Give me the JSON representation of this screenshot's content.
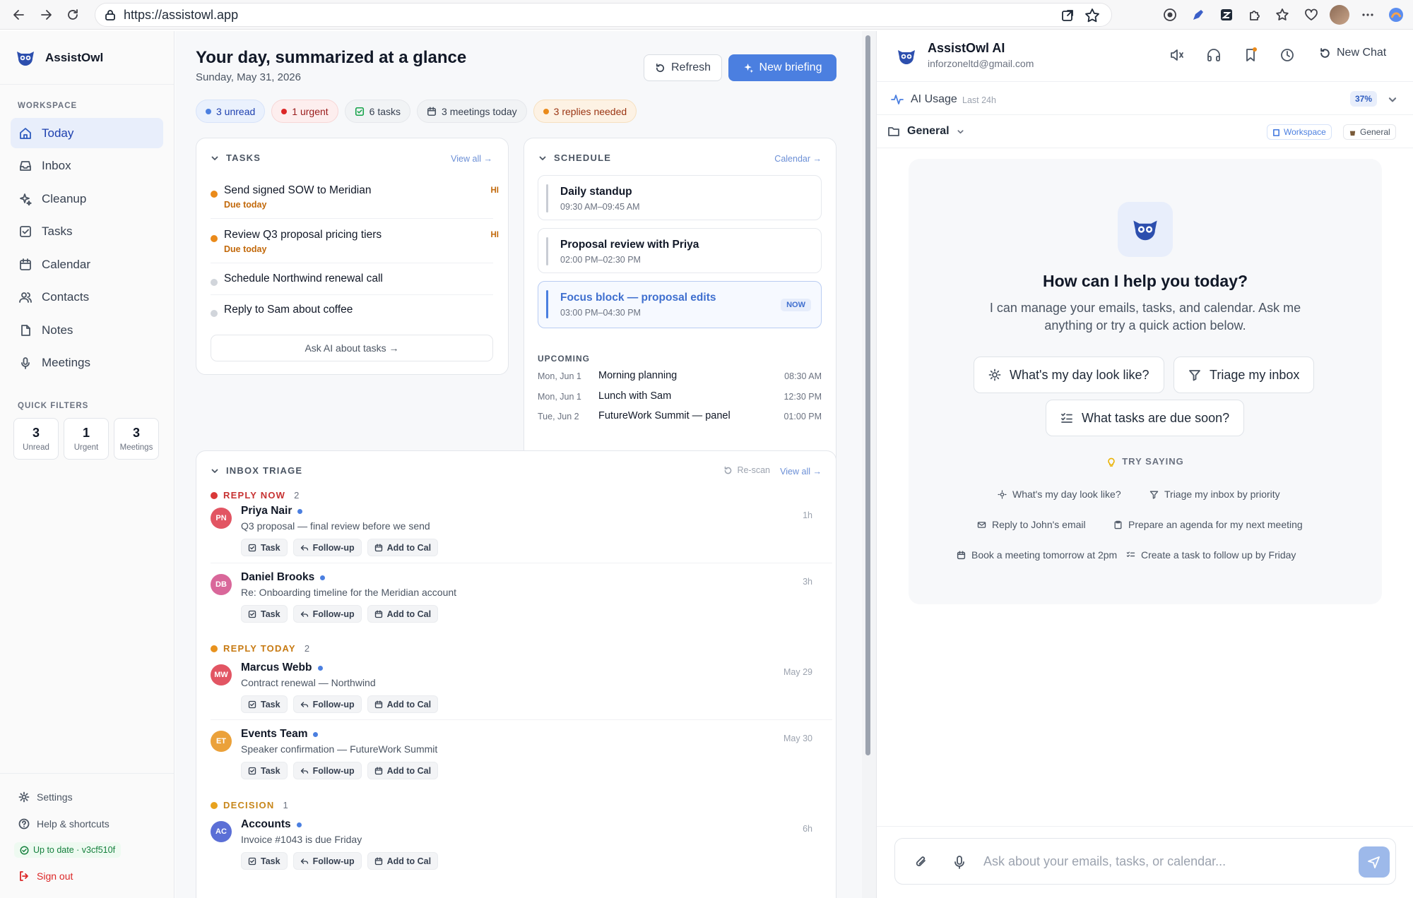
{
  "browser": {
    "url": "https://assistowl.app"
  },
  "sidebar": {
    "app_name": "AssistOwl",
    "workspace_label": "WORKSPACE",
    "nav": [
      {
        "label": "Today",
        "icon": "home-icon",
        "active": true
      },
      {
        "label": "Inbox",
        "icon": "inbox-icon"
      },
      {
        "label": "Cleanup",
        "icon": "sparkles-icon"
      },
      {
        "label": "Tasks",
        "icon": "checkbox-icon"
      },
      {
        "label": "Calendar",
        "icon": "calendar-icon"
      },
      {
        "label": "Contacts",
        "icon": "contacts-icon"
      },
      {
        "label": "Notes",
        "icon": "notes-icon"
      },
      {
        "label": "Meetings",
        "icon": "mic-icon"
      }
    ],
    "quick_filters_label": "QUICK FILTERS",
    "quick_filters": [
      {
        "count": "3",
        "label": "Unread"
      },
      {
        "count": "1",
        "label": "Urgent"
      },
      {
        "count": "3",
        "label": "Meetings"
      }
    ],
    "settings": "Settings",
    "help": "Help & shortcuts",
    "status": "Up to date · v3cf510f",
    "signout": "Sign out"
  },
  "main": {
    "title": "Your day, summarized at a glance",
    "date": "Sunday, May 31, 2026",
    "refresh_label": "Refresh",
    "new_briefing_label": "New briefing",
    "chips": [
      "3 unread",
      "1 urgent",
      "6 tasks",
      "3 meetings today",
      "3 replies needed"
    ],
    "tasks": {
      "header": "TASKS",
      "link": "View all →",
      "items": [
        {
          "title": "Send signed SOW to Meridian",
          "due": "Due today",
          "priority": "HI"
        },
        {
          "title": "Review Q3 proposal pricing tiers",
          "due": "Due today",
          "priority": "HI"
        },
        {
          "title": "Schedule Northwind renewal call"
        },
        {
          "title": "Reply to Sam about coffee"
        }
      ],
      "ask_label": "Ask AI about tasks →"
    },
    "schedule": {
      "header": "SCHEDULE",
      "link": "Calendar →",
      "events": [
        {
          "title": "Daily standup",
          "time": "09:30 AM–09:45 AM"
        },
        {
          "title": "Proposal review with Priya",
          "time": "02:00 PM–02:30 PM"
        },
        {
          "title": "Focus block — proposal edits",
          "time": "03:00 PM–04:30 PM",
          "badge": "NOW"
        }
      ],
      "upcoming_label": "UPCOMING",
      "upcoming": [
        {
          "date": "Mon, Jun 1",
          "title": "Morning planning",
          "time": "08:30 AM"
        },
        {
          "date": "Mon, Jun 1",
          "title": "Lunch with Sam",
          "time": "12:30 PM"
        },
        {
          "date": "Tue, Jun 2",
          "title": "FutureWork Summit — panel",
          "time": "01:00 PM"
        }
      ]
    },
    "inbox": {
      "header": "INBOX TRIAGE",
      "rescan": "Re-scan",
      "link": "View all →",
      "action_labels": {
        "task": "Task",
        "follow": "Follow-up",
        "cal": "Add to Cal"
      },
      "groups": [
        {
          "label": "REPLY NOW",
          "count": "2",
          "color": "#d93838"
        },
        {
          "label": "REPLY TODAY",
          "count": "2",
          "color": "#e8921e"
        },
        {
          "label": "DECISION",
          "count": "1",
          "color": "#e8a21e"
        }
      ],
      "messages": [
        {
          "initials": "PN",
          "from": "Priya Nair",
          "subject": "Q3 proposal — final review before we send",
          "time": "1h",
          "color": "#e25563"
        },
        {
          "initials": "DB",
          "from": "Daniel Brooks",
          "subject": "Re: Onboarding timeline for the Meridian account",
          "time": "3h",
          "color": "#d9679a"
        },
        {
          "initials": "MW",
          "from": "Marcus Webb",
          "subject": "Contract renewal — Northwind",
          "time": "May 29",
          "color": "#e25563"
        },
        {
          "initials": "ET",
          "from": "Events Team",
          "subject": "Speaker confirmation — FutureWork Summit",
          "time": "May 30",
          "color": "#eba13a"
        },
        {
          "initials": "AC",
          "from": "Accounts",
          "subject": "Invoice #1043 is due Friday",
          "time": "6h",
          "color": "#5b6fd6"
        }
      ]
    }
  },
  "panel": {
    "title": "AssistOwl AI",
    "email": "inforzoneltd@gmail.com",
    "new_chat": "New Chat",
    "usage_label": "AI Usage",
    "usage_range": "Last 24h",
    "usage_pct": "37%",
    "folder": "General",
    "tag_workspace": "Workspace",
    "tag_general": "General",
    "welcome_title": "How can I help you today?",
    "welcome_sub": "I can manage your emails, tasks, and calendar. Ask me anything or try a quick action below.",
    "quick_actions": [
      "What's my day look like?",
      "Triage my inbox",
      "What tasks are due soon?"
    ],
    "try_label": "TRY SAYING",
    "suggestions": [
      "What's my day look like?",
      "Triage my inbox by priority",
      "Reply to John's email",
      "Prepare an agenda for my next meeting",
      "Book a meeting tomorrow at 2pm",
      "Create a task to follow up by Friday"
    ],
    "input_placeholder": "Ask about your emails, tasks, or calendar..."
  }
}
